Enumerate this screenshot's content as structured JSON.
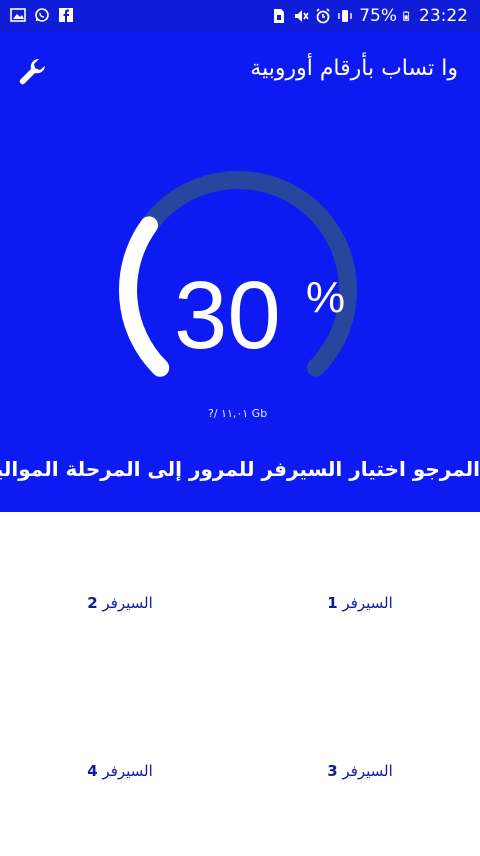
{
  "status_bar": {
    "battery": "75%",
    "time": "23:22",
    "left_icons": [
      "image-icon",
      "whatsapp-icon",
      "facebook-icon"
    ],
    "right_icons": [
      "sim-icon",
      "mute-icon",
      "alarm-icon",
      "vibrate-icon",
      "battery-icon"
    ]
  },
  "header": {
    "title": "وا تساب بأرقام أوروبية",
    "settings_icon": "wrench-icon"
  },
  "progress": {
    "percent_number": "30",
    "percent_sign": "%",
    "value_percent": 30,
    "size_label": "?/ ١١,٠١ Gb"
  },
  "instruction": "المرجو اختيار السيرفر للمرور إلى المرحلة الموالية",
  "servers": [
    {
      "label": "السيرفر",
      "number": "1"
    },
    {
      "label": "السيرفر",
      "number": "2"
    },
    {
      "label": "السيرفر",
      "number": "3"
    },
    {
      "label": "السيرفر",
      "number": "4"
    }
  ],
  "colors": {
    "status_bar": "#0f1cd8",
    "primary": "#0d1bf2",
    "gauge_track": "#27479f",
    "gauge_fill": "#ffffff",
    "server_text": "#111c99"
  }
}
